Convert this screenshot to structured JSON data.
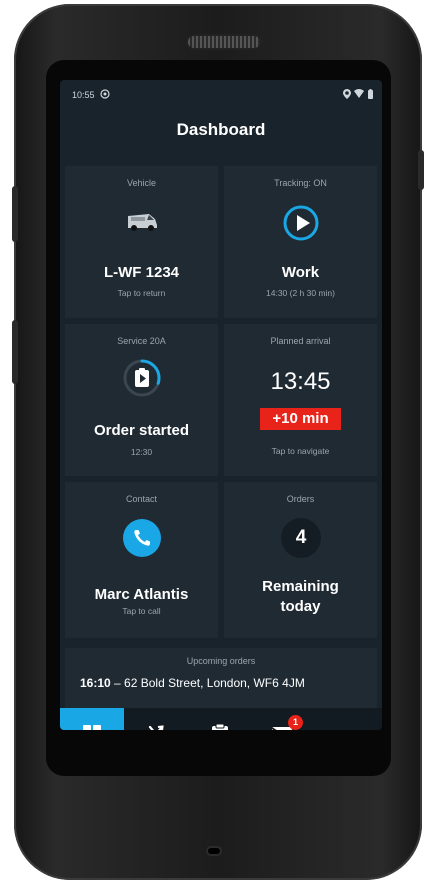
{
  "status_bar": {
    "time": "10:55"
  },
  "header": {
    "title": "Dashboard"
  },
  "tiles": {
    "vehicle": {
      "caption": "Vehicle",
      "value": "L-WF 1234",
      "sub": "Tap to return"
    },
    "tracking": {
      "caption": "Tracking: ON",
      "value": "Work",
      "sub": "14:30 (2 h 30 min)"
    },
    "service": {
      "caption": "Service 20A",
      "value": "Order started",
      "sub": "12:30",
      "progress_fraction": 0.3
    },
    "arrival": {
      "caption": "Planned arrival",
      "value": "13:45",
      "delay": "+10 min",
      "sub": "Tap to navigate"
    },
    "contact": {
      "caption": "Contact",
      "value": "Marc Atlantis",
      "sub": "Tap to call"
    },
    "orders": {
      "caption": "Orders",
      "count": "4",
      "value_line1": "Remaining",
      "value_line2": "today"
    }
  },
  "upcoming": {
    "caption": "Upcoming orders",
    "time": "16:10",
    "separator": " – ",
    "address": "62 Bold Street, London, WF6 4JM"
  },
  "nav": {
    "items": [
      {
        "icon": "dashboard-grid-icon",
        "active": true
      },
      {
        "icon": "route-icon",
        "active": false
      },
      {
        "icon": "clipboard-icon",
        "active": false
      },
      {
        "icon": "mail-icon",
        "active": false,
        "badge": "1"
      },
      {
        "icon": "more-icon",
        "active": false
      }
    ]
  },
  "colors": {
    "accent": "#1aa7e6",
    "delay_red": "#e8231a",
    "tile": "#1f2a33",
    "screen": "#19232b"
  }
}
